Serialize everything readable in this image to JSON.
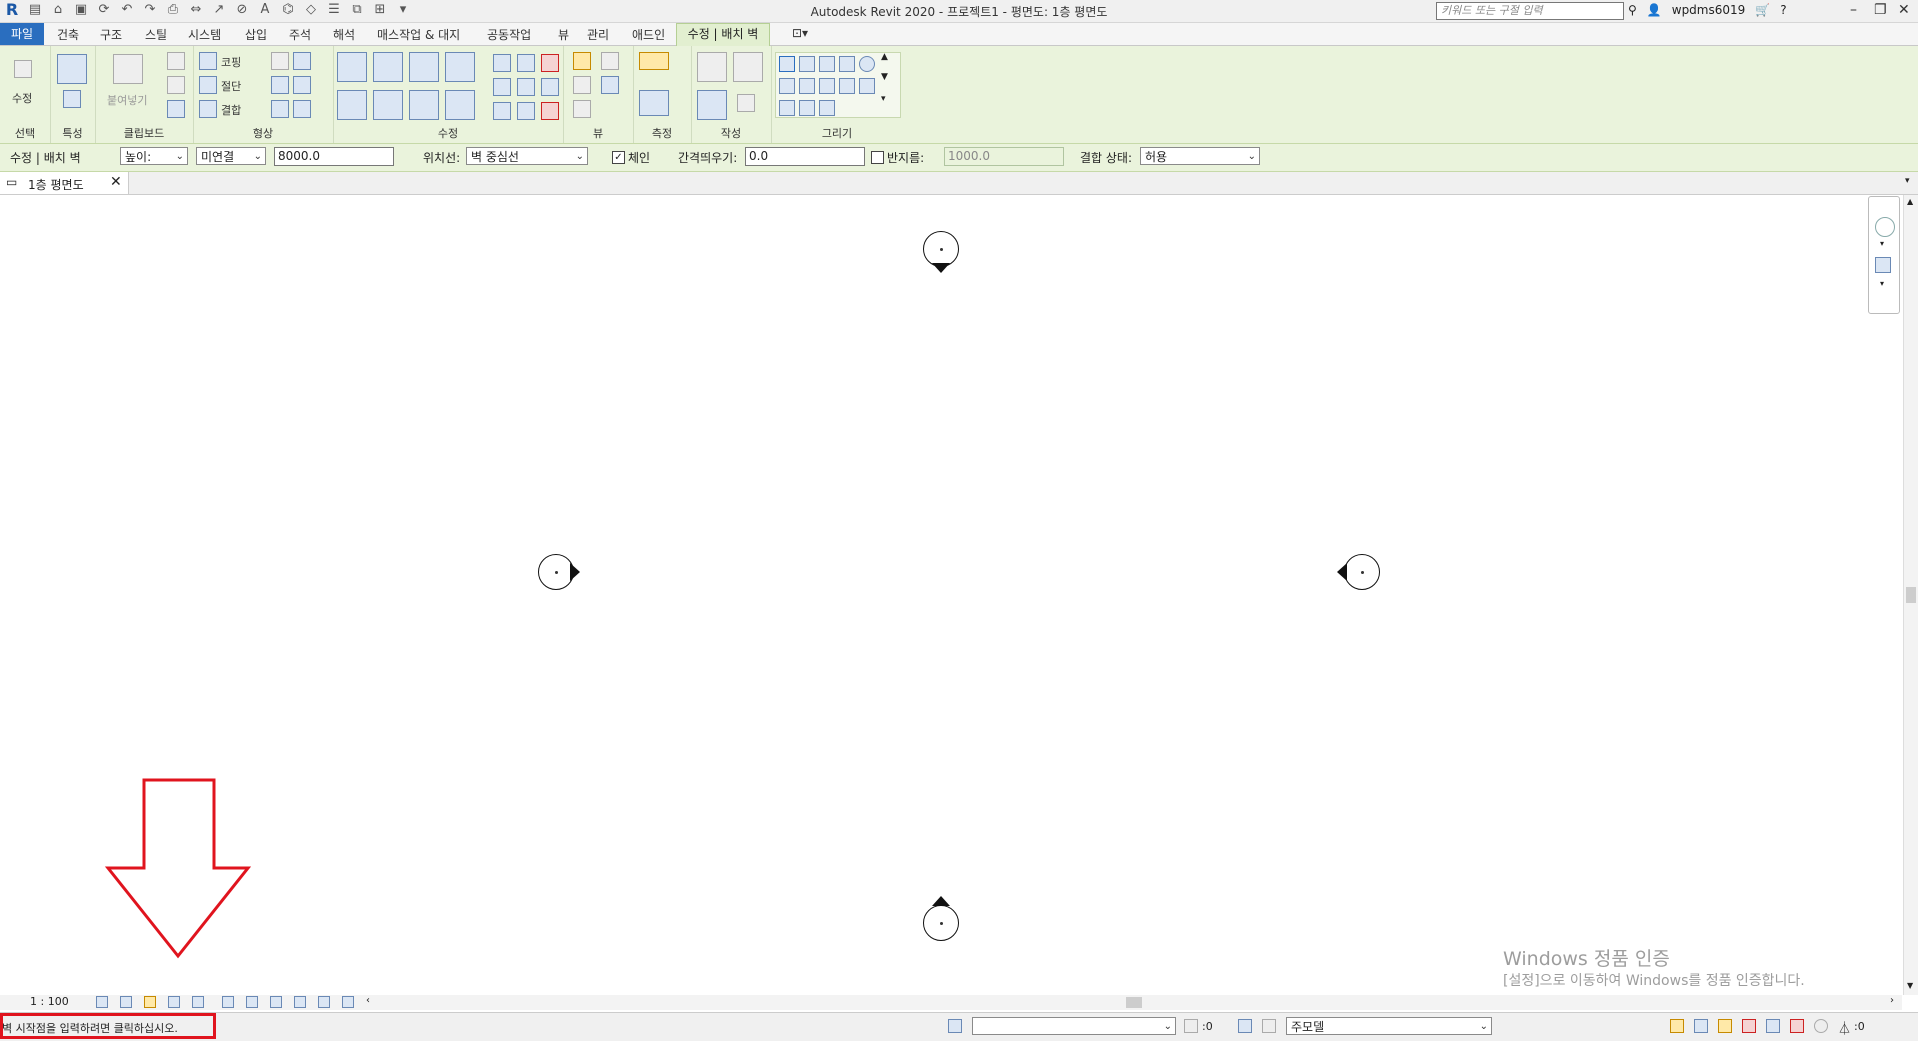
{
  "app": {
    "title": "Autodesk Revit 2020 - 프로젝트1 - 평면도: 1층 평면도",
    "search_placeholder": "키워드 또는 구절 입력",
    "username": "wpdms6019"
  },
  "menu": {
    "file": "파일",
    "tabs": [
      "건축",
      "구조",
      "스틸",
      "시스템",
      "삽입",
      "주석",
      "해석",
      "매스작업 & 대지",
      "공동작업",
      "뷰",
      "관리",
      "애드인"
    ],
    "active_tab": "수정 | 배치 벽"
  },
  "ribbon": {
    "select_label": "선택",
    "properties_label": "특성",
    "clipboard_label": "클립보드",
    "geometry_label": "형상",
    "modify_label": "수정",
    "view_label": "뷰",
    "measure_label": "측정",
    "create_label": "작성",
    "draw_label": "그리기",
    "modify_button": "수정",
    "paste_button": "붙여넣기",
    "cope_label": "코핑",
    "cut_label": "절단",
    "join_label": "결합"
  },
  "options": {
    "context": "수정 | 배치 벽",
    "height_mode": "높이:",
    "constraint": "미연결",
    "height_value": "8000.0",
    "location_line_label": "위치선:",
    "location_line_value": "벽 중심선",
    "chain_label": "체인",
    "chain_checked": true,
    "offset_label": "간격띄우기:",
    "offset_value": "0.0",
    "radius_label": "반지름:",
    "radius_value": "1000.0",
    "radius_checked": false,
    "join_status_label": "결합 상태:",
    "join_status_value": "허용"
  },
  "view_tab": {
    "name": "1층 평면도"
  },
  "view_controls": {
    "scale": "1 : 100"
  },
  "status": {
    "message": "벽 시작점을 입력하려면 클릭하십시오.",
    "worksets_count": ":0",
    "model": "주모델",
    "filter_count": ":0"
  },
  "watermark": {
    "line1": "Windows 정품 인증",
    "line2": "[설정]으로 이동하여 Windows를 정품 인증합니다."
  },
  "colors": {
    "ribbon_bg": "#eaf3dc",
    "file_tab": "#2a6ebf",
    "annotation_red": "#e0141e"
  }
}
